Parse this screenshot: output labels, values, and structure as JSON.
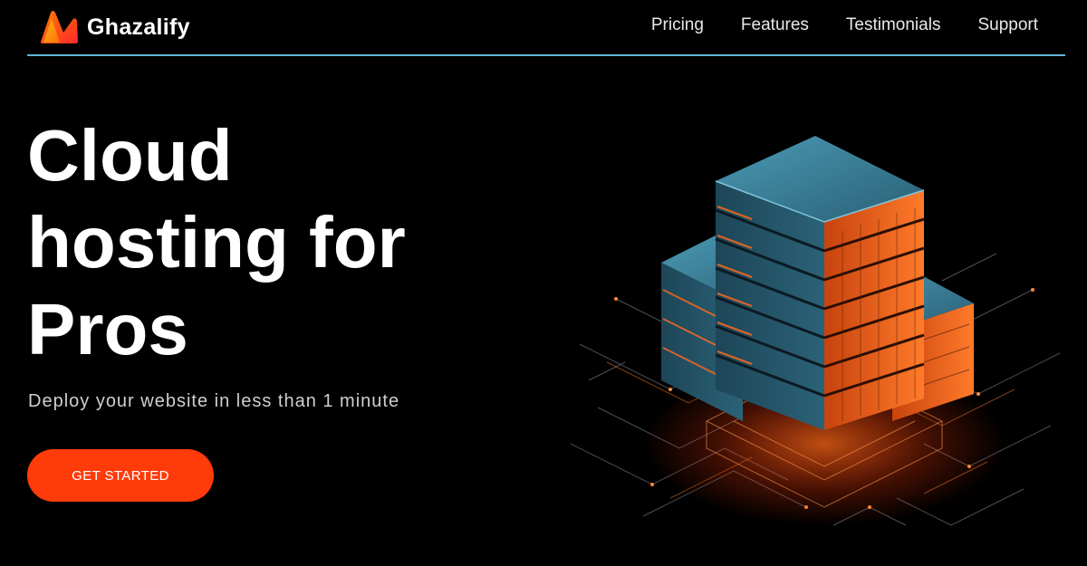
{
  "brand": {
    "name": "Ghazalify",
    "logo_icon": "ghazalify-logo-icon"
  },
  "nav": {
    "items": [
      {
        "label": "Pricing"
      },
      {
        "label": "Features"
      },
      {
        "label": "Testimonials"
      },
      {
        "label": "Support"
      }
    ]
  },
  "hero": {
    "title_lines": [
      "Cloud",
      "hosting for",
      "Pros"
    ],
    "subtitle": "Deploy your website in less than 1 minute",
    "cta_label": "GET STARTED",
    "illustration_icon": "server-stack-illustration"
  },
  "colors": {
    "background": "#000000",
    "accent": "#ff3b0a",
    "divider": "#5fb7d6",
    "server_blue": "#2f6f86",
    "server_orange": "#ff6a1a"
  }
}
